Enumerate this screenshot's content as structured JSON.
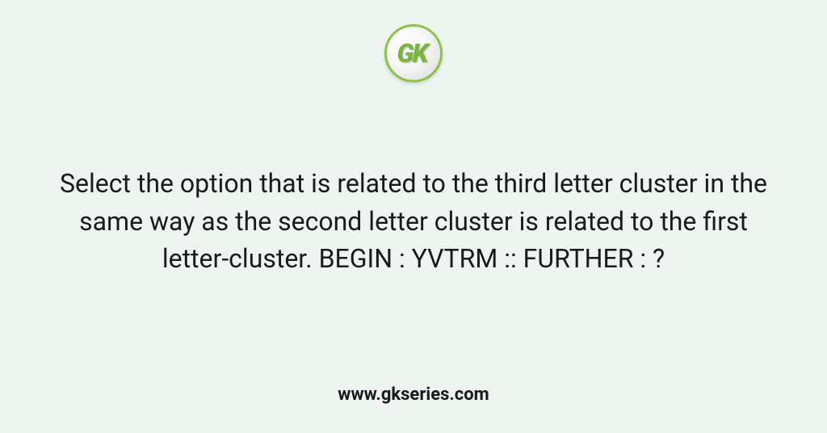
{
  "logo": {
    "text": "GK"
  },
  "question": {
    "text": "Select the option that is related to the third letter cluster in the same way as the second letter cluster is related to the first letter-cluster. BEGIN : YVTRM :: FURTHER : ?"
  },
  "footer": {
    "url": "www.gkseries.com"
  }
}
